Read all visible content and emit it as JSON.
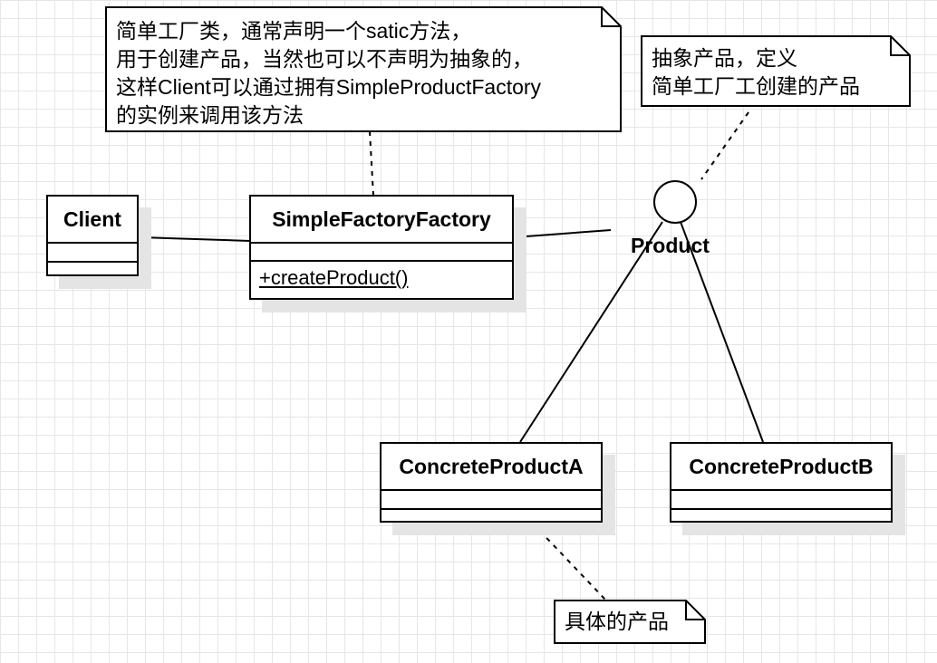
{
  "diagram": {
    "classes": {
      "client": {
        "name": "Client",
        "operations": []
      },
      "factory": {
        "name": "SimpleFactoryFactory",
        "operations": [
          "+createProduct()"
        ]
      },
      "product_a": {
        "name": "ConcreteProductA",
        "operations": []
      },
      "product_b": {
        "name": "ConcreteProductB",
        "operations": []
      }
    },
    "interface": {
      "name": "Product"
    },
    "notes": {
      "factory_note": "简单工厂类，通常声明一个satic方法，\n用于创建产品，当然也可以不声明为抽象的，\n这样Client可以通过拥有SimpleProductFactory\n的实例来调用该方法",
      "product_note": "抽象产品，定义\n简单工厂工创建的产品",
      "concrete_note": "具体的产品"
    }
  }
}
